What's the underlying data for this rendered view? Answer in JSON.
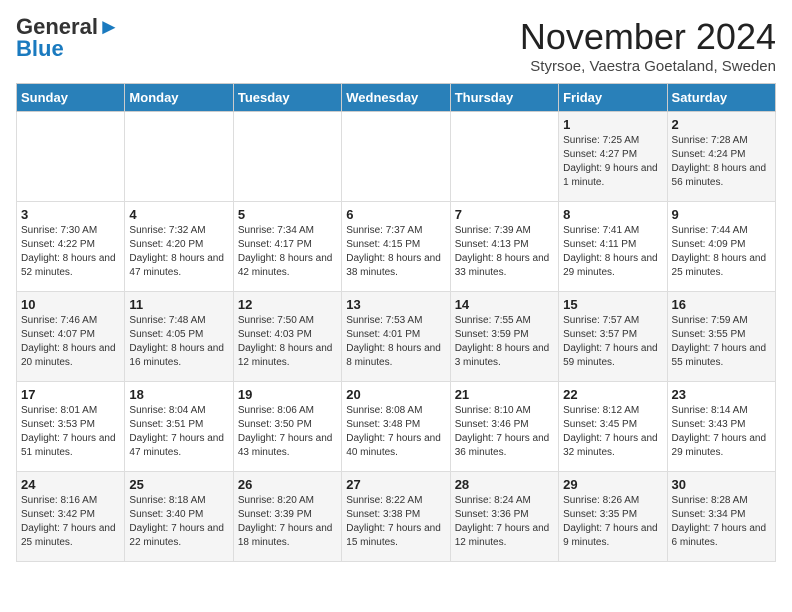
{
  "logo": {
    "general": "General",
    "blue": "Blue"
  },
  "title": "November 2024",
  "subtitle": "Styrsoe, Vaestra Goetaland, Sweden",
  "days_of_week": [
    "Sunday",
    "Monday",
    "Tuesday",
    "Wednesday",
    "Thursday",
    "Friday",
    "Saturday"
  ],
  "weeks": [
    [
      {
        "day": "",
        "info": ""
      },
      {
        "day": "",
        "info": ""
      },
      {
        "day": "",
        "info": ""
      },
      {
        "day": "",
        "info": ""
      },
      {
        "day": "",
        "info": ""
      },
      {
        "day": "1",
        "info": "Sunrise: 7:25 AM\nSunset: 4:27 PM\nDaylight: 9 hours and 1 minute."
      },
      {
        "day": "2",
        "info": "Sunrise: 7:28 AM\nSunset: 4:24 PM\nDaylight: 8 hours and 56 minutes."
      }
    ],
    [
      {
        "day": "3",
        "info": "Sunrise: 7:30 AM\nSunset: 4:22 PM\nDaylight: 8 hours and 52 minutes."
      },
      {
        "day": "4",
        "info": "Sunrise: 7:32 AM\nSunset: 4:20 PM\nDaylight: 8 hours and 47 minutes."
      },
      {
        "day": "5",
        "info": "Sunrise: 7:34 AM\nSunset: 4:17 PM\nDaylight: 8 hours and 42 minutes."
      },
      {
        "day": "6",
        "info": "Sunrise: 7:37 AM\nSunset: 4:15 PM\nDaylight: 8 hours and 38 minutes."
      },
      {
        "day": "7",
        "info": "Sunrise: 7:39 AM\nSunset: 4:13 PM\nDaylight: 8 hours and 33 minutes."
      },
      {
        "day": "8",
        "info": "Sunrise: 7:41 AM\nSunset: 4:11 PM\nDaylight: 8 hours and 29 minutes."
      },
      {
        "day": "9",
        "info": "Sunrise: 7:44 AM\nSunset: 4:09 PM\nDaylight: 8 hours and 25 minutes."
      }
    ],
    [
      {
        "day": "10",
        "info": "Sunrise: 7:46 AM\nSunset: 4:07 PM\nDaylight: 8 hours and 20 minutes."
      },
      {
        "day": "11",
        "info": "Sunrise: 7:48 AM\nSunset: 4:05 PM\nDaylight: 8 hours and 16 minutes."
      },
      {
        "day": "12",
        "info": "Sunrise: 7:50 AM\nSunset: 4:03 PM\nDaylight: 8 hours and 12 minutes."
      },
      {
        "day": "13",
        "info": "Sunrise: 7:53 AM\nSunset: 4:01 PM\nDaylight: 8 hours and 8 minutes."
      },
      {
        "day": "14",
        "info": "Sunrise: 7:55 AM\nSunset: 3:59 PM\nDaylight: 8 hours and 3 minutes."
      },
      {
        "day": "15",
        "info": "Sunrise: 7:57 AM\nSunset: 3:57 PM\nDaylight: 7 hours and 59 minutes."
      },
      {
        "day": "16",
        "info": "Sunrise: 7:59 AM\nSunset: 3:55 PM\nDaylight: 7 hours and 55 minutes."
      }
    ],
    [
      {
        "day": "17",
        "info": "Sunrise: 8:01 AM\nSunset: 3:53 PM\nDaylight: 7 hours and 51 minutes."
      },
      {
        "day": "18",
        "info": "Sunrise: 8:04 AM\nSunset: 3:51 PM\nDaylight: 7 hours and 47 minutes."
      },
      {
        "day": "19",
        "info": "Sunrise: 8:06 AM\nSunset: 3:50 PM\nDaylight: 7 hours and 43 minutes."
      },
      {
        "day": "20",
        "info": "Sunrise: 8:08 AM\nSunset: 3:48 PM\nDaylight: 7 hours and 40 minutes."
      },
      {
        "day": "21",
        "info": "Sunrise: 8:10 AM\nSunset: 3:46 PM\nDaylight: 7 hours and 36 minutes."
      },
      {
        "day": "22",
        "info": "Sunrise: 8:12 AM\nSunset: 3:45 PM\nDaylight: 7 hours and 32 minutes."
      },
      {
        "day": "23",
        "info": "Sunrise: 8:14 AM\nSunset: 3:43 PM\nDaylight: 7 hours and 29 minutes."
      }
    ],
    [
      {
        "day": "24",
        "info": "Sunrise: 8:16 AM\nSunset: 3:42 PM\nDaylight: 7 hours and 25 minutes."
      },
      {
        "day": "25",
        "info": "Sunrise: 8:18 AM\nSunset: 3:40 PM\nDaylight: 7 hours and 22 minutes."
      },
      {
        "day": "26",
        "info": "Sunrise: 8:20 AM\nSunset: 3:39 PM\nDaylight: 7 hours and 18 minutes."
      },
      {
        "day": "27",
        "info": "Sunrise: 8:22 AM\nSunset: 3:38 PM\nDaylight: 7 hours and 15 minutes."
      },
      {
        "day": "28",
        "info": "Sunrise: 8:24 AM\nSunset: 3:36 PM\nDaylight: 7 hours and 12 minutes."
      },
      {
        "day": "29",
        "info": "Sunrise: 8:26 AM\nSunset: 3:35 PM\nDaylight: 7 hours and 9 minutes."
      },
      {
        "day": "30",
        "info": "Sunrise: 8:28 AM\nSunset: 3:34 PM\nDaylight: 7 hours and 6 minutes."
      }
    ]
  ]
}
